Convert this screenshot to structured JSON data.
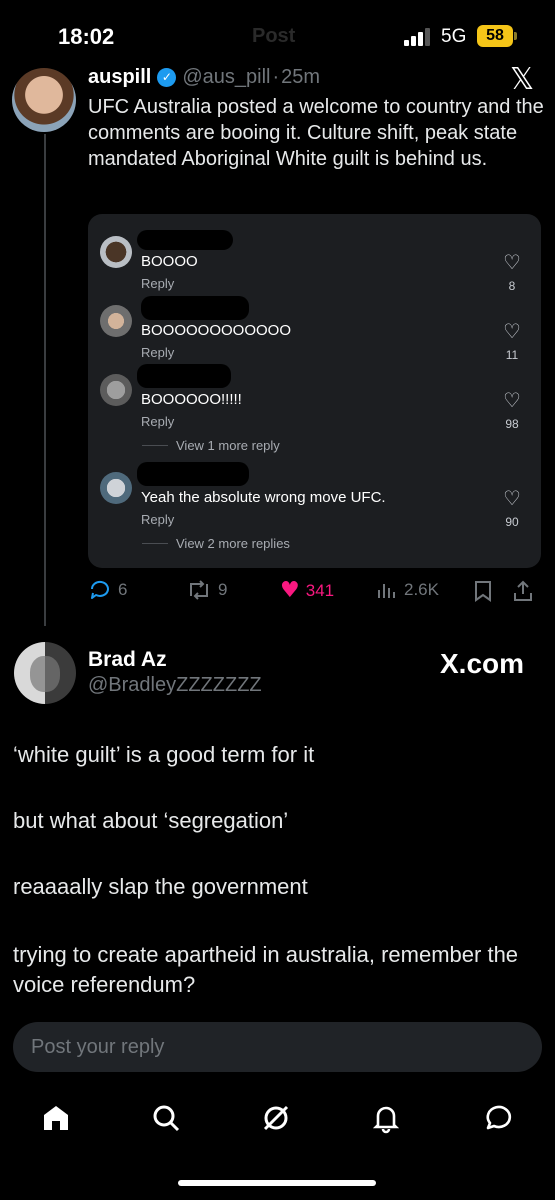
{
  "status_bar": {
    "time": "18:02",
    "network": "5G",
    "battery": "58",
    "background_title": "Post"
  },
  "main_tweet": {
    "name": "auspill",
    "handle": "@aus_pill",
    "separator": "·",
    "age": "25m",
    "text": "UFC Australia posted a welcome to country and the comments are booing it. Culture shift, peak state mandated Aboriginal White guilt is behind us.",
    "embedded_comments": [
      {
        "text": "BOOOO",
        "reply": "Reply",
        "likes": "8"
      },
      {
        "text": "BOOOOOOOOOOOO",
        "reply": "Reply",
        "likes": "11"
      },
      {
        "text": "BOOOOOO!!!!!",
        "reply": "Reply",
        "likes": "98",
        "more": "View 1 more reply"
      },
      {
        "text": "Yeah the absolute wrong move UFC.",
        "reply": "Reply",
        "likes": "90",
        "more": "View 2 more replies"
      }
    ],
    "actions": {
      "replies": "6",
      "reposts": "9",
      "likes": "341",
      "views": "2.6K"
    }
  },
  "reply": {
    "name": "Brad Az",
    "handle": "@BradleyZZZZZZZ",
    "brand": "X.com",
    "paragraphs": [
      "‘white guilt’ is a good term for it",
      "but what about ‘segregation’",
      "reaaaally slap the government",
      "trying to create apartheid in australia, remember the voice referendum?"
    ]
  },
  "composer": {
    "placeholder": "Post your reply"
  },
  "colors": {
    "background": "#000000",
    "accent_blue": "#1d9bf0",
    "like_pink": "#f91880",
    "battery_yellow": "#f5c518",
    "muted": "#71767b"
  },
  "icons": {
    "tabs": [
      "home-icon",
      "search-icon",
      "grok-icon",
      "notifications-icon",
      "messages-icon"
    ]
  }
}
